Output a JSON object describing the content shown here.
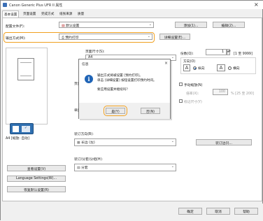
{
  "window": {
    "title": "Canon Generic Plus UFR II 属性"
  },
  "tabs": [
    {
      "label": "基本设置",
      "active": true
    },
    {
      "label": "页面设置",
      "active": false
    },
    {
      "label": "完成方式",
      "active": false
    },
    {
      "label": "纸张来源",
      "active": false
    },
    {
      "label": "质量",
      "active": false
    }
  ],
  "profile": {
    "label": "配置文件(F):",
    "value": "默认设置",
    "add_button": "添加(1)...",
    "edit_button": "编辑(2)..."
  },
  "output_method": {
    "label": "输出方式(M):",
    "value": "预约打印",
    "details_button": "详细设置(E)..."
  },
  "preview": {
    "caption": "A4 [缩放: 自动]"
  },
  "left_buttons": {
    "view_settings": "查看设置(V)",
    "language_settings": "Language Settings(W)...",
    "restore_defaults": "恢复默认设置(R)"
  },
  "page_size": {
    "label": "页面尺寸(S):",
    "value": "A4"
  },
  "copies": {
    "label": "份数(Q):",
    "value": "1",
    "range": "[1 至 9999]"
  },
  "orientation": {
    "label": "方向(O)",
    "portrait": "纵向",
    "landscape": "横向",
    "selected": "portrait"
  },
  "partial_labels": {
    "page_layout": "页面",
    "duplex": "单面"
  },
  "manual_scaling": {
    "checkbox_label": "手动缩放(N)",
    "ratio_label": "倍率(X):",
    "ratio_value": "100",
    "ratio_range": "% [25 至 200]",
    "draft_label": "标记尺寸(Y)"
  },
  "binding": {
    "label": "装订方向(B):",
    "value": "长边 (左)",
    "location_button": "装订边(I)..."
  },
  "stapling": {
    "label": "装订/分套/分组(H):",
    "value": "分套"
  },
  "footer": {
    "ok": "确定",
    "cancel": "取消",
    "help": "帮助"
  },
  "dialog": {
    "title": "信息",
    "message_lines": [
      "输出方式将被设置 [预约打印]。",
      "单击 [详细设置] 按钮设置打印预约时间。",
      "",
      "要应用设置并继续吗？"
    ],
    "yes_button": "是(Y)",
    "no_button": "否(N)"
  },
  "colors": {
    "highlight": "#f0a020",
    "info_icon": "#1f64b6",
    "window_bg": "#f0f0f0"
  }
}
